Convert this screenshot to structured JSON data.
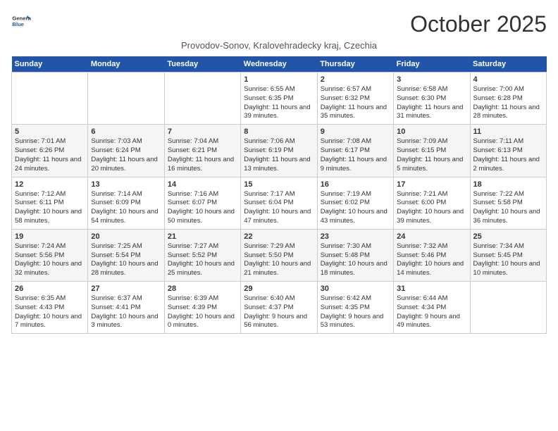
{
  "app": {
    "name": "GeneralBlue",
    "title": "October 2025",
    "location": "Provodov-Sonov, Kralovehradecky kraj, Czechia"
  },
  "weekdays": [
    "Sunday",
    "Monday",
    "Tuesday",
    "Wednesday",
    "Thursday",
    "Friday",
    "Saturday"
  ],
  "weeks": [
    [
      {
        "day": "",
        "detail": ""
      },
      {
        "day": "",
        "detail": ""
      },
      {
        "day": "",
        "detail": ""
      },
      {
        "day": "1",
        "detail": "Sunrise: 6:55 AM\nSunset: 6:35 PM\nDaylight: 11 hours\nand 39 minutes."
      },
      {
        "day": "2",
        "detail": "Sunrise: 6:57 AM\nSunset: 6:32 PM\nDaylight: 11 hours\nand 35 minutes."
      },
      {
        "day": "3",
        "detail": "Sunrise: 6:58 AM\nSunset: 6:30 PM\nDaylight: 11 hours\nand 31 minutes."
      },
      {
        "day": "4",
        "detail": "Sunrise: 7:00 AM\nSunset: 6:28 PM\nDaylight: 11 hours\nand 28 minutes."
      }
    ],
    [
      {
        "day": "5",
        "detail": "Sunrise: 7:01 AM\nSunset: 6:26 PM\nDaylight: 11 hours\nand 24 minutes."
      },
      {
        "day": "6",
        "detail": "Sunrise: 7:03 AM\nSunset: 6:24 PM\nDaylight: 11 hours\nand 20 minutes."
      },
      {
        "day": "7",
        "detail": "Sunrise: 7:04 AM\nSunset: 6:21 PM\nDaylight: 11 hours\nand 16 minutes."
      },
      {
        "day": "8",
        "detail": "Sunrise: 7:06 AM\nSunset: 6:19 PM\nDaylight: 11 hours\nand 13 minutes."
      },
      {
        "day": "9",
        "detail": "Sunrise: 7:08 AM\nSunset: 6:17 PM\nDaylight: 11 hours\nand 9 minutes."
      },
      {
        "day": "10",
        "detail": "Sunrise: 7:09 AM\nSunset: 6:15 PM\nDaylight: 11 hours\nand 5 minutes."
      },
      {
        "day": "11",
        "detail": "Sunrise: 7:11 AM\nSunset: 6:13 PM\nDaylight: 11 hours\nand 2 minutes."
      }
    ],
    [
      {
        "day": "12",
        "detail": "Sunrise: 7:12 AM\nSunset: 6:11 PM\nDaylight: 10 hours\nand 58 minutes."
      },
      {
        "day": "13",
        "detail": "Sunrise: 7:14 AM\nSunset: 6:09 PM\nDaylight: 10 hours\nand 54 minutes."
      },
      {
        "day": "14",
        "detail": "Sunrise: 7:16 AM\nSunset: 6:07 PM\nDaylight: 10 hours\nand 50 minutes."
      },
      {
        "day": "15",
        "detail": "Sunrise: 7:17 AM\nSunset: 6:04 PM\nDaylight: 10 hours\nand 47 minutes."
      },
      {
        "day": "16",
        "detail": "Sunrise: 7:19 AM\nSunset: 6:02 PM\nDaylight: 10 hours\nand 43 minutes."
      },
      {
        "day": "17",
        "detail": "Sunrise: 7:21 AM\nSunset: 6:00 PM\nDaylight: 10 hours\nand 39 minutes."
      },
      {
        "day": "18",
        "detail": "Sunrise: 7:22 AM\nSunset: 5:58 PM\nDaylight: 10 hours\nand 36 minutes."
      }
    ],
    [
      {
        "day": "19",
        "detail": "Sunrise: 7:24 AM\nSunset: 5:56 PM\nDaylight: 10 hours\nand 32 minutes."
      },
      {
        "day": "20",
        "detail": "Sunrise: 7:25 AM\nSunset: 5:54 PM\nDaylight: 10 hours\nand 28 minutes."
      },
      {
        "day": "21",
        "detail": "Sunrise: 7:27 AM\nSunset: 5:52 PM\nDaylight: 10 hours\nand 25 minutes."
      },
      {
        "day": "22",
        "detail": "Sunrise: 7:29 AM\nSunset: 5:50 PM\nDaylight: 10 hours\nand 21 minutes."
      },
      {
        "day": "23",
        "detail": "Sunrise: 7:30 AM\nSunset: 5:48 PM\nDaylight: 10 hours\nand 18 minutes."
      },
      {
        "day": "24",
        "detail": "Sunrise: 7:32 AM\nSunset: 5:46 PM\nDaylight: 10 hours\nand 14 minutes."
      },
      {
        "day": "25",
        "detail": "Sunrise: 7:34 AM\nSunset: 5:45 PM\nDaylight: 10 hours\nand 10 minutes."
      }
    ],
    [
      {
        "day": "26",
        "detail": "Sunrise: 6:35 AM\nSunset: 4:43 PM\nDaylight: 10 hours\nand 7 minutes."
      },
      {
        "day": "27",
        "detail": "Sunrise: 6:37 AM\nSunset: 4:41 PM\nDaylight: 10 hours\nand 3 minutes."
      },
      {
        "day": "28",
        "detail": "Sunrise: 6:39 AM\nSunset: 4:39 PM\nDaylight: 10 hours\nand 0 minutes."
      },
      {
        "day": "29",
        "detail": "Sunrise: 6:40 AM\nSunset: 4:37 PM\nDaylight: 9 hours\nand 56 minutes."
      },
      {
        "day": "30",
        "detail": "Sunrise: 6:42 AM\nSunset: 4:35 PM\nDaylight: 9 hours\nand 53 minutes."
      },
      {
        "day": "31",
        "detail": "Sunrise: 6:44 AM\nSunset: 4:34 PM\nDaylight: 9 hours\nand 49 minutes."
      },
      {
        "day": "",
        "detail": ""
      }
    ]
  ]
}
